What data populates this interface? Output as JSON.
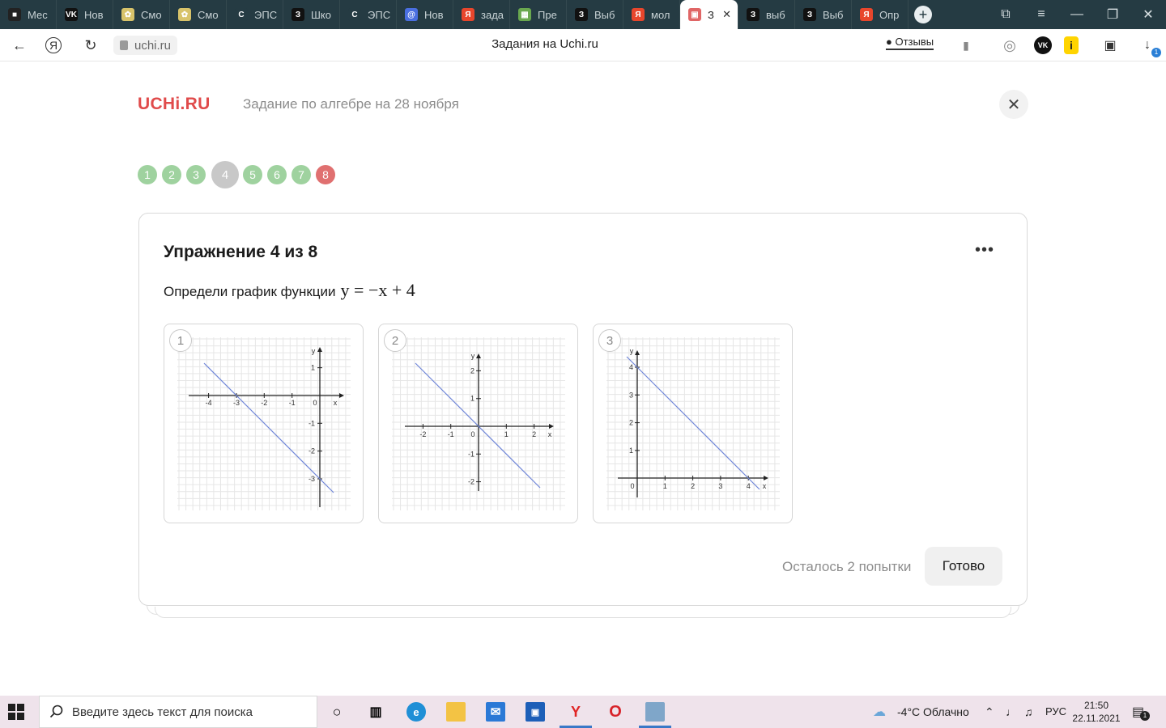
{
  "browser": {
    "tabs": [
      {
        "label": "Мес",
        "icon": "messenger-icon",
        "color": "#222222",
        "glyph": "■"
      },
      {
        "label": "Нов",
        "icon": "vk-icon",
        "color": "#111111",
        "glyph": "VK"
      },
      {
        "label": "Смо",
        "icon": "flower-icon",
        "color": "#d8c36a",
        "glyph": "✿"
      },
      {
        "label": "Смо",
        "icon": "flower-icon",
        "color": "#d8c36a",
        "glyph": "✿"
      },
      {
        "label": "ЭПС",
        "icon": "eps-icon",
        "color": "#253b43",
        "glyph": "С"
      },
      {
        "label": "Шко",
        "icon": "znanija-icon",
        "color": "#111111",
        "glyph": "З"
      },
      {
        "label": "ЭПС",
        "icon": "eps-icon",
        "color": "#253b43",
        "glyph": "С"
      },
      {
        "label": "Нов",
        "icon": "at-icon",
        "color": "#4a6fe0",
        "glyph": "@"
      },
      {
        "label": "зада",
        "icon": "yandex-icon",
        "color": "#e8462c",
        "glyph": "Я"
      },
      {
        "label": "Пре",
        "icon": "microsoft-icon",
        "color": "#6aa84f",
        "glyph": "▦"
      },
      {
        "label": "Выб",
        "icon": "znanija-icon",
        "color": "#111111",
        "glyph": "З"
      },
      {
        "label": "мол",
        "icon": "yandex-icon",
        "color": "#e8462c",
        "glyph": "Я"
      },
      {
        "label": "З",
        "icon": "uchi-icon",
        "color": "#e06666",
        "glyph": "▣",
        "active": true
      },
      {
        "label": "выб",
        "icon": "znanija-icon",
        "color": "#111111",
        "glyph": "З"
      },
      {
        "label": "Выб",
        "icon": "znanija-icon",
        "color": "#111111",
        "glyph": "З"
      },
      {
        "label": "Опр",
        "icon": "yandex-icon",
        "color": "#e8462c",
        "glyph": "Я"
      }
    ],
    "url": "uchi.ru",
    "page_title": "Задания на Uchi.ru",
    "feedback_label": "Отзывы",
    "downloads_badge": "1"
  },
  "page": {
    "logo": "UCHi.RU",
    "subtitle": "Задание по алгебре на 28 ноября",
    "progress": [
      {
        "label": "1",
        "state": "done"
      },
      {
        "label": "2",
        "state": "done"
      },
      {
        "label": "3",
        "state": "done"
      },
      {
        "label": "4",
        "state": "current"
      },
      {
        "label": "5",
        "state": "done"
      },
      {
        "label": "6",
        "state": "done"
      },
      {
        "label": "7",
        "state": "done"
      },
      {
        "label": "8",
        "state": "wrong"
      }
    ],
    "exercise_title": "Упражнение 4 из 8",
    "question_text": "Определи график функции",
    "formula": "y = −x + 4",
    "options": [
      {
        "number": "1",
        "x_ticks": [
          "-4",
          "-3",
          "-2",
          "-1",
          "0"
        ],
        "y_ticks": [
          "1",
          "-1",
          "-2",
          "-3"
        ],
        "x_axis_label": "x",
        "y_axis_label": "y"
      },
      {
        "number": "2",
        "x_ticks": [
          "-2",
          "-1",
          "0",
          "1",
          "2"
        ],
        "y_ticks": [
          "2",
          "1",
          "-1",
          "-2"
        ],
        "x_axis_label": "x",
        "y_axis_label": "y"
      },
      {
        "number": "3",
        "x_ticks": [
          "0",
          "1",
          "2",
          "3",
          "4"
        ],
        "y_ticks": [
          "4",
          "3",
          "2",
          "1"
        ],
        "x_axis_label": "x",
        "y_axis_label": "y"
      }
    ],
    "attempts_text": "Осталось 2 попытки",
    "done_label": "Готово"
  },
  "taskbar": {
    "search_placeholder": "Введите здесь текст для поиска",
    "weather": "-4°C  Облачно",
    "language": "РУС",
    "time": "21:50",
    "date": "22.11.2021",
    "notification_badge": "1"
  }
}
